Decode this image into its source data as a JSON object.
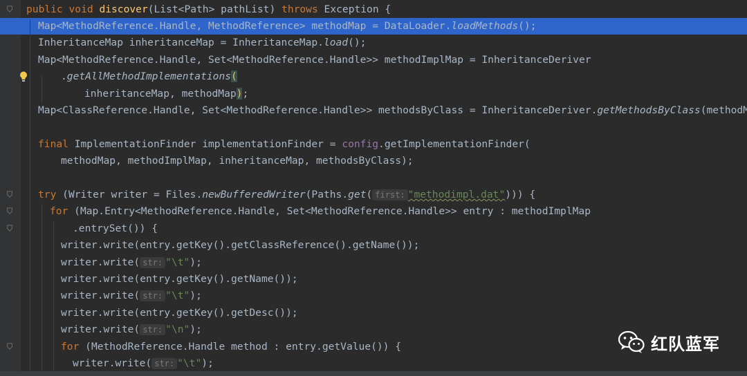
{
  "editor": {
    "lines": [
      {
        "tokens": [
          {
            "t": "public void ",
            "s": "keyword"
          },
          {
            "t": "discover",
            "s": "method"
          },
          {
            "t": "(List<Path> pathList) ",
            "s": "default"
          },
          {
            "t": "throws ",
            "s": "keyword"
          },
          {
            "t": "Exception {",
            "s": "default"
          }
        ]
      },
      {
        "tokens": [
          {
            "t": "Map<MethodReference.Handle, MethodReference> methodMap = DataLoader.",
            "s": "default"
          },
          {
            "t": "loadMethods",
            "s": "static"
          },
          {
            "t": "();",
            "s": "default"
          }
        ]
      },
      {
        "tokens": [
          {
            "t": "InheritanceMap inheritanceMap = InheritanceMap.",
            "s": "default"
          },
          {
            "t": "load",
            "s": "static"
          },
          {
            "t": "();",
            "s": "default"
          }
        ]
      },
      {
        "tokens": [
          {
            "t": "Map<MethodReference.Handle, Set<MethodReference.Handle>> methodImplMap = InheritanceDeriver",
            "s": "default"
          }
        ]
      },
      {
        "tokens": [
          {
            "t": ".",
            "s": "default"
          },
          {
            "t": "getAllMethodImplementations",
            "s": "static"
          },
          {
            "t": "(",
            "s": "paren"
          }
        ]
      },
      {
        "tokens": [
          {
            "t": "inheritanceMap, methodMap",
            "s": "default"
          },
          {
            "t": ")",
            "s": "paren"
          },
          {
            "t": ";",
            "s": "default"
          }
        ]
      },
      {
        "tokens": [
          {
            "t": "Map<ClassReference.Handle, Set<MethodReference.Handle>> methodsByClass = InheritanceDeriver.",
            "s": "default"
          },
          {
            "t": "getMethodsByClass",
            "s": "static"
          },
          {
            "t": "(methodMap);",
            "s": "default"
          }
        ]
      },
      {
        "tokens": []
      },
      {
        "tokens": [
          {
            "t": "final ",
            "s": "keyword"
          },
          {
            "t": "ImplementationFinder implementationFinder = ",
            "s": "default"
          },
          {
            "t": "config",
            "s": "field"
          },
          {
            "t": ".getImplementationFinder(",
            "s": "default"
          }
        ]
      },
      {
        "tokens": [
          {
            "t": "methodMap, methodImplMap, inheritanceMap, methodsByClass);",
            "s": "default"
          }
        ]
      },
      {
        "tokens": []
      },
      {
        "tokens": [
          {
            "t": "try ",
            "s": "keyword"
          },
          {
            "t": "(Writer writer = Files.",
            "s": "default"
          },
          {
            "t": "newBufferedWriter",
            "s": "static"
          },
          {
            "t": "(Paths.",
            "s": "default"
          },
          {
            "t": "get",
            "s": "static"
          },
          {
            "t": "(",
            "s": "default"
          },
          {
            "t": "first:",
            "s": "hint"
          },
          {
            "t": "\"methodimpl.dat\"",
            "s": "squiggle"
          },
          {
            "t": "))) {",
            "s": "default"
          }
        ]
      },
      {
        "tokens": [
          {
            "t": "for ",
            "s": "keyword"
          },
          {
            "t": "(Map.Entry<MethodReference.Handle, Set<MethodReference.Handle>> entry : methodImplMap",
            "s": "default"
          }
        ]
      },
      {
        "tokens": [
          {
            "t": ".entrySet()) {",
            "s": "default"
          }
        ]
      },
      {
        "tokens": [
          {
            "t": "writer.write(entry.getKey().getClassReference().getName());",
            "s": "default"
          }
        ]
      },
      {
        "tokens": [
          {
            "t": "writer.write(",
            "s": "default"
          },
          {
            "t": "str:",
            "s": "hint"
          },
          {
            "t": "\"\\t\"",
            "s": "string"
          },
          {
            "t": ");",
            "s": "default"
          }
        ]
      },
      {
        "tokens": [
          {
            "t": "writer.write(entry.getKey().getName());",
            "s": "default"
          }
        ]
      },
      {
        "tokens": [
          {
            "t": "writer.write(",
            "s": "default"
          },
          {
            "t": "str:",
            "s": "hint"
          },
          {
            "t": "\"\\t\"",
            "s": "string"
          },
          {
            "t": ");",
            "s": "default"
          }
        ]
      },
      {
        "tokens": [
          {
            "t": "writer.write(entry.getKey().getDesc());",
            "s": "default"
          }
        ]
      },
      {
        "tokens": [
          {
            "t": "writer.write(",
            "s": "default"
          },
          {
            "t": "str:",
            "s": "hint"
          },
          {
            "t": "\"\\n\"",
            "s": "string"
          },
          {
            "t": ");",
            "s": "default"
          }
        ]
      },
      {
        "tokens": [
          {
            "t": "for ",
            "s": "keyword"
          },
          {
            "t": "(MethodReference.Handle method : entry.getValue()) {",
            "s": "default"
          }
        ]
      },
      {
        "tokens": [
          {
            "t": "writer.write(",
            "s": "default"
          },
          {
            "t": "str:",
            "s": "hint"
          },
          {
            "t": "\"\\t\"",
            "s": "string"
          },
          {
            "t": ");",
            "s": "default"
          }
        ]
      }
    ]
  },
  "gutter_icons": [
    "fold-icon",
    "lightbulb-icon"
  ],
  "watermark": {
    "icon": "wechat-icon",
    "text": "红队蓝军"
  },
  "colors": {
    "background": "#2b2b2b",
    "gutter": "#313335",
    "selection": "#2f65ca",
    "keyword": "#cc7832",
    "method": "#ffc66d",
    "string": "#6a8759",
    "field": "#9876aa",
    "text": "#a9b7c6"
  }
}
